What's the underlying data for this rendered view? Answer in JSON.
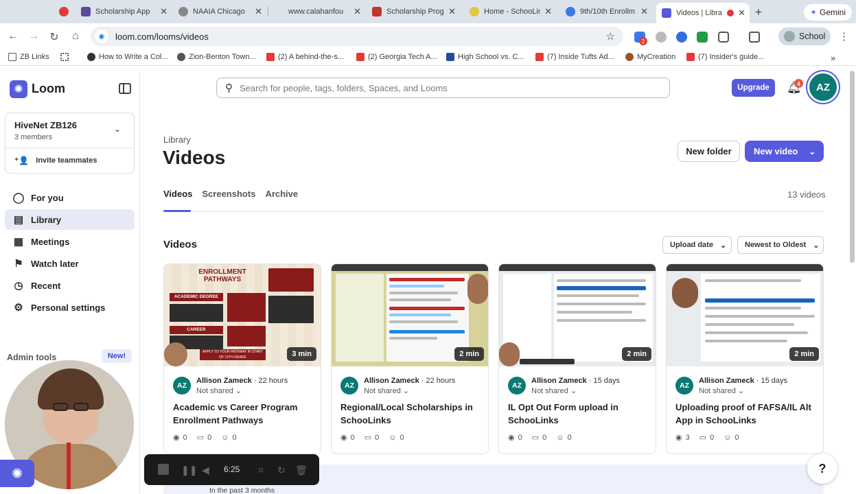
{
  "browser": {
    "tabs": [
      {
        "label": "",
        "x": 0
      },
      {
        "label": "Scholarship App",
        "x": 1
      },
      {
        "label": "NAAIA Chicago",
        "x": 2
      },
      {
        "label": "www.calahanfou",
        "x": 3
      },
      {
        "label": "Scholarship Prog",
        "x": 4
      },
      {
        "label": "Home - SchooLinks",
        "x": 5
      },
      {
        "label": "9th/10th Enrollm",
        "x": 6
      },
      {
        "label": "Videos | Libra",
        "x": 7
      }
    ],
    "gemini_label": "Gemini",
    "url": "loom.com/looms/videos",
    "profile_label": "School",
    "ext_badge": "2",
    "bookmarks": [
      "ZB Links",
      "How to Write a Col...",
      "Zion-Benton Town...",
      "(2) A behind-the-s...",
      "(2) Georgia Tech A...",
      "High School vs. C...",
      "(7) Inside Tufts Ad...",
      "MyCreation",
      "(7) Insider's guide..."
    ]
  },
  "sidebar": {
    "brand": "Loom",
    "workspace_name": "HiveNet ZB126",
    "workspace_members": "3 members",
    "invite_label": "Invite teammates",
    "nav": [
      {
        "label": "For you"
      },
      {
        "label": "Library"
      },
      {
        "label": "Meetings"
      },
      {
        "label": "Watch later"
      },
      {
        "label": "Recent"
      },
      {
        "label": "Personal settings"
      }
    ],
    "admin_tools_label": "Admin tools",
    "new_badge": "New!"
  },
  "header": {
    "search_placeholder": "Search for people, tags, folders, Spaces, and Looms",
    "upgrade_label": "Upgrade",
    "notification_count": "4",
    "avatar_initials": "AZ"
  },
  "library": {
    "breadcrumb": "Library",
    "title": "Videos",
    "new_folder_label": "New folder",
    "new_video_label": "New video",
    "tabs": [
      "Videos",
      "Screenshots",
      "Archive"
    ],
    "video_count": "13 videos",
    "section_title": "Videos",
    "sort_field": "Upload date",
    "sort_order": "Newest to Oldest"
  },
  "videos": [
    {
      "duration": "3 min",
      "initials": "AZ",
      "owner": "Allison Zameck",
      "age": "22 hours",
      "sharing": "Not shared",
      "title": "Academic vs Career Program Enrollment Pathways",
      "views": "0",
      "comments": "0",
      "reactions": "0"
    },
    {
      "duration": "2 min",
      "initials": "AZ",
      "owner": "Allison Zameck",
      "age": "22 hours",
      "sharing": "Not shared",
      "title": "Regional/Local Scholarships in SchooLinks",
      "views": "0",
      "comments": "0",
      "reactions": "0"
    },
    {
      "duration": "2 min",
      "initials": "AZ",
      "owner": "Allison Zameck",
      "age": "15 days",
      "sharing": "Not shared",
      "title": "IL Opt Out Form upload in SchooLinks",
      "views": "0",
      "comments": "0",
      "reactions": "0"
    },
    {
      "duration": "2 min",
      "initials": "AZ",
      "owner": "Allison Zameck",
      "age": "15 days",
      "sharing": "Not shared",
      "title": "Uploading proof of FAFSA/IL Alt App in SchooLinks",
      "views": "3",
      "comments": "0",
      "reactions": "0"
    }
  ],
  "thumb1_text": {
    "heading": "ENROLLMENT PATHWAYS",
    "left1": "ACADEMIC DEGREE",
    "left2": "CAREER",
    "footer": "APPLY TO YOUR PATHWAY IN START OF 12TH GRADE"
  },
  "recorder": {
    "time": "6:25"
  },
  "bottom": {
    "past_label": "In the past 3 months",
    "help_label": "?"
  },
  "colors": {
    "brand": "#565ADD",
    "avatar": "#0a7a73",
    "tab_strip": "#dde3ea"
  }
}
